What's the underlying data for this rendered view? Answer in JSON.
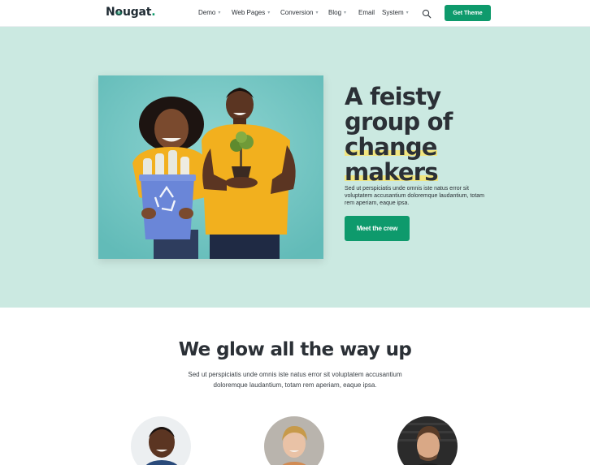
{
  "header": {
    "logo": {
      "prefix": "N",
      "o": "o",
      "rest": "ugat",
      "dot": "."
    },
    "nav": [
      {
        "label": "Demo",
        "has_dropdown": true
      },
      {
        "label": "Web Pages",
        "has_dropdown": true
      },
      {
        "label": "Conversion",
        "has_dropdown": true
      },
      {
        "label": "Blog",
        "has_dropdown": true
      },
      {
        "label": "Email",
        "has_dropdown": false
      },
      {
        "label": "System",
        "has_dropdown": true
      }
    ],
    "search_icon": "search-icon",
    "cta_label": "Get Theme"
  },
  "hero": {
    "title_lines": [
      "A feisty",
      "group of",
      "change",
      "makers"
    ],
    "highlighted_lines": [
      "change",
      "makers"
    ],
    "text": "Sed ut perspiciatis unde omnis iste natus error sit voluptatem accusantium doloremque laudantium, totam rem aperiam, eaque ipsa.",
    "cta_label": "Meet the crew",
    "photo_icon": "recycle-icon"
  },
  "team_section": {
    "title": "We glow all the way up",
    "text": "Sed ut perspiciatis unde omnis iste natus error sit voluptatem accusantium doloremque laudantium, totam rem aperiam, eaque ipsa."
  },
  "colors": {
    "accent": "#0e9a6c",
    "hero_bg": "#cbe9e1",
    "highlight": "#f7e46e",
    "text": "#2b3036"
  }
}
